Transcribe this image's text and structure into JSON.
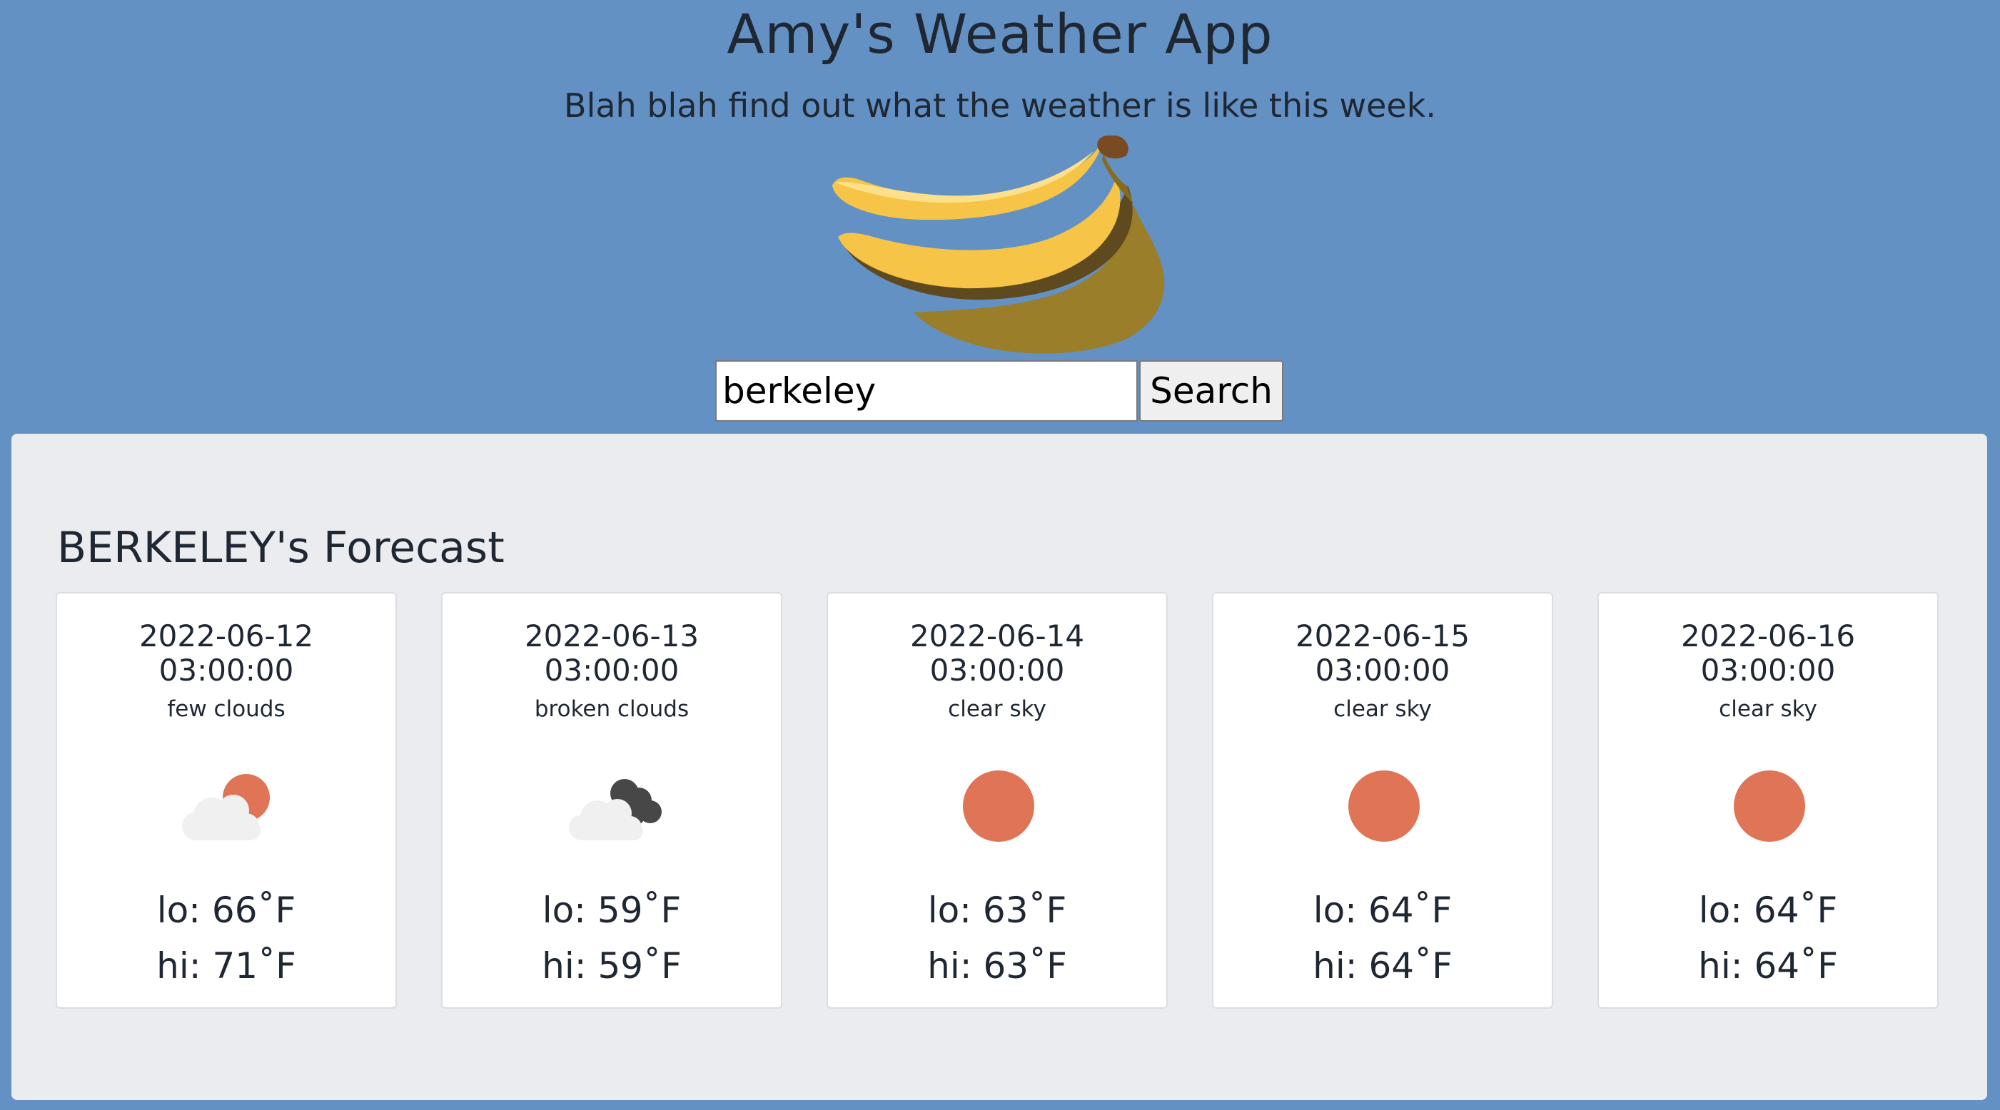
{
  "header": {
    "title": "Amy's Weather App",
    "tagline": "Blah blah find out what the weather is like this week."
  },
  "search": {
    "value": "berkeley",
    "button_label": "Search"
  },
  "forecast": {
    "title": "BERKELEY's Forecast",
    "days": [
      {
        "date": "2022-06-12",
        "time": "03:00:00",
        "description": "few clouds",
        "icon": "few-clouds-icon",
        "lo": "lo: 66˚F",
        "hi": "hi: 71˚F"
      },
      {
        "date": "2022-06-13",
        "time": "03:00:00",
        "description": "broken clouds",
        "icon": "broken-clouds-icon",
        "lo": "lo: 59˚F",
        "hi": "hi: 59˚F"
      },
      {
        "date": "2022-06-14",
        "time": "03:00:00",
        "description": "clear sky",
        "icon": "sun-icon",
        "lo": "lo: 63˚F",
        "hi": "hi: 63˚F"
      },
      {
        "date": "2022-06-15",
        "time": "03:00:00",
        "description": "clear sky",
        "icon": "sun-icon",
        "lo": "lo: 64˚F",
        "hi": "hi: 64˚F"
      },
      {
        "date": "2022-06-16",
        "time": "03:00:00",
        "description": "clear sky",
        "icon": "sun-icon",
        "lo": "lo: 64˚F",
        "hi": "hi: 64˚F"
      }
    ]
  },
  "colors": {
    "page_background": "#6391c4",
    "panel_background": "#ebecef",
    "sun": "#e07456",
    "cloud_light": "#f0f0f0",
    "cloud_dark": "#474747",
    "banana": "#f6c447"
  }
}
